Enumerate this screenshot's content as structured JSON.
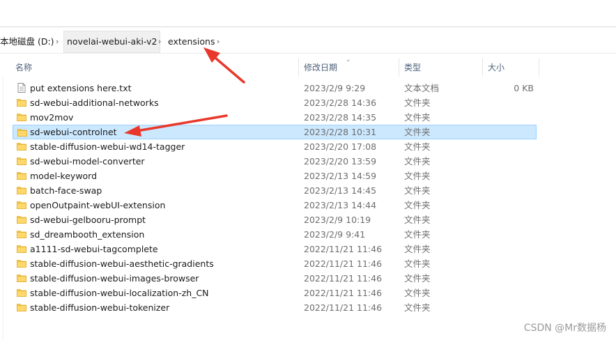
{
  "breadcrumb": {
    "drive": "本地磁盘 (D:)",
    "folder1": "novelai-webui-aki-v2",
    "folder2": "extensions",
    "separator": "›"
  },
  "columns": {
    "name": "名称",
    "modified": "修改日期",
    "type": "类型",
    "size": "大小",
    "sort_indicator": "⌄"
  },
  "files": [
    {
      "name": "put extensions here.txt",
      "date": "2023/2/9 9:29",
      "type": "文本文档",
      "size": "0 KB",
      "icon": "text-file-icon"
    },
    {
      "name": "sd-webui-additional-networks",
      "date": "2023/2/28 14:36",
      "type": "文件夹",
      "size": "",
      "icon": "folder-icon"
    },
    {
      "name": "mov2mov",
      "date": "2023/2/28 14:35",
      "type": "文件夹",
      "size": "",
      "icon": "folder-icon"
    },
    {
      "name": "sd-webui-controlnet",
      "date": "2023/2/28 10:31",
      "type": "文件夹",
      "size": "",
      "icon": "folder-icon",
      "selected": true
    },
    {
      "name": "stable-diffusion-webui-wd14-tagger",
      "date": "2023/2/20 17:08",
      "type": "文件夹",
      "size": "",
      "icon": "folder-icon"
    },
    {
      "name": "sd-webui-model-converter",
      "date": "2023/2/20 13:59",
      "type": "文件夹",
      "size": "",
      "icon": "folder-icon"
    },
    {
      "name": "model-keyword",
      "date": "2023/2/13 14:59",
      "type": "文件夹",
      "size": "",
      "icon": "folder-icon"
    },
    {
      "name": "batch-face-swap",
      "date": "2023/2/13 14:45",
      "type": "文件夹",
      "size": "",
      "icon": "folder-icon"
    },
    {
      "name": "openOutpaint-webUI-extension",
      "date": "2023/2/13 14:44",
      "type": "文件夹",
      "size": "",
      "icon": "folder-icon"
    },
    {
      "name": "sd-webui-gelbooru-prompt",
      "date": "2023/2/9 10:19",
      "type": "文件夹",
      "size": "",
      "icon": "folder-icon"
    },
    {
      "name": "sd_dreambooth_extension",
      "date": "2023/2/9 9:41",
      "type": "文件夹",
      "size": "",
      "icon": "folder-icon"
    },
    {
      "name": "a1111-sd-webui-tagcomplete",
      "date": "2022/11/21 11:46",
      "type": "文件夹",
      "size": "",
      "icon": "folder-icon"
    },
    {
      "name": "stable-diffusion-webui-aesthetic-gradients",
      "date": "2022/11/21 11:46",
      "type": "文件夹",
      "size": "",
      "icon": "folder-icon"
    },
    {
      "name": "stable-diffusion-webui-images-browser",
      "date": "2022/11/21 11:46",
      "type": "文件夹",
      "size": "",
      "icon": "folder-icon"
    },
    {
      "name": "stable-diffusion-webui-localization-zh_CN",
      "date": "2022/11/21 11:46",
      "type": "文件夹",
      "size": "",
      "icon": "folder-icon"
    },
    {
      "name": "stable-diffusion-webui-tokenizer",
      "date": "2022/11/21 11:46",
      "type": "文件夹",
      "size": "",
      "icon": "folder-icon"
    }
  ],
  "watermark": "CSDN @Mr数据杨",
  "colors": {
    "selection_bg": "#cce8ff",
    "selection_border": "#99d1ff",
    "folder_fill": "#ffd86b",
    "annotation_arrow": "#e8382b",
    "header_text": "#4c607a"
  }
}
